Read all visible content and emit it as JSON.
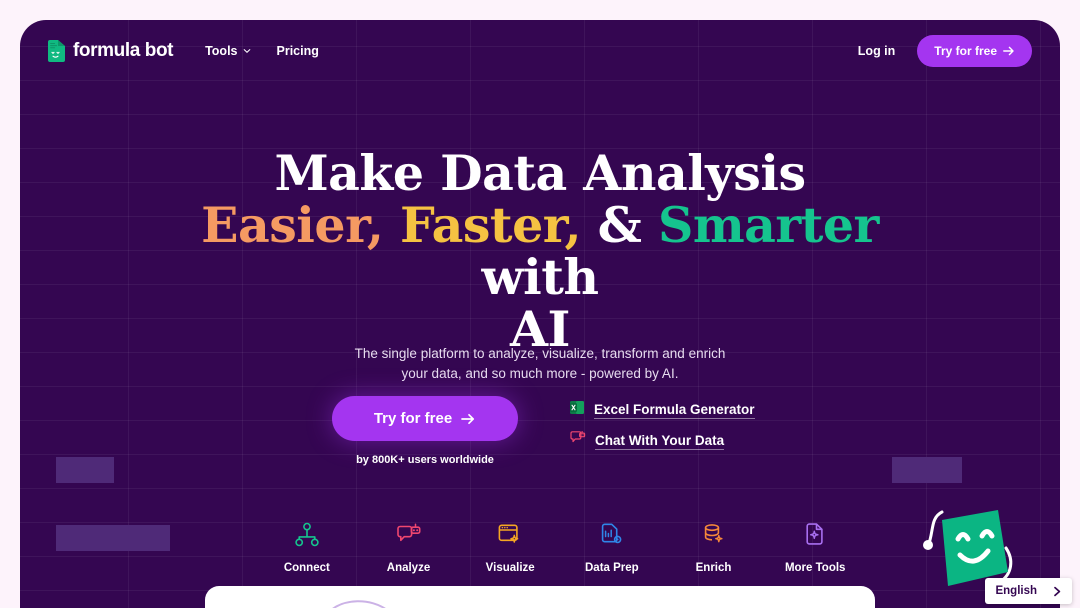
{
  "brand": {
    "name": "formula bot",
    "mark_icon": "formula-bot-logo-icon"
  },
  "nav": {
    "links": [
      {
        "label": "Tools",
        "icon": "chevron-down-icon"
      },
      {
        "label": "Pricing",
        "icon": ""
      }
    ],
    "login_label": "Log in",
    "cta_label": "Try for free",
    "cta_icon": "arrow-right-icon"
  },
  "hero": {
    "headline": {
      "line1": "Make Data Analysis",
      "w_easier": "Easier,",
      "w_faster": "Faster,",
      "amp": "&",
      "w_smarter": "Smarter",
      "tail": "with",
      "line3": "AI"
    },
    "subhead": "The single platform to analyze, visualize, transform and enrich your data, and so much more - powered by AI.",
    "cta_label": "Try for free",
    "cta_icon": "arrow-right-icon",
    "cta_note": "by 800K+ users worldwide",
    "tool_links": [
      {
        "label": "Excel Formula Generator",
        "icon": "excel-icon"
      },
      {
        "label": "Chat With Your Data",
        "icon": "chat-bot-icon"
      }
    ]
  },
  "tabs": [
    {
      "label": "Connect",
      "icon": "node-hierarchy-icon",
      "color": "#15c48e",
      "active": true
    },
    {
      "label": "Analyze",
      "icon": "chat-bot-icon",
      "color": "#f0476f",
      "active": false
    },
    {
      "label": "Visualize",
      "icon": "window-sparkle-icon",
      "color": "#f5a623",
      "active": false
    },
    {
      "label": "Data Prep",
      "icon": "document-gear-icon",
      "color": "#2f86e8",
      "active": false
    },
    {
      "label": "Enrich",
      "icon": "database-sparkle-icon",
      "color": "#f5883a",
      "active": false
    },
    {
      "label": "More Tools",
      "icon": "document-sparkle-icon",
      "color": "#a86ff0",
      "active": false
    }
  ],
  "language": {
    "label": "English",
    "icon": "chevron-right-icon"
  },
  "mascot": {
    "icon": "green-mascot-smiley-icon"
  },
  "colors": {
    "page_bg": "#fdf3fb",
    "panel_bg": "#340651",
    "accent_purple": "#a435f0",
    "accent_green": "#15c48e",
    "accent_orange": "#f59a62",
    "accent_yellow": "#f5c242"
  }
}
